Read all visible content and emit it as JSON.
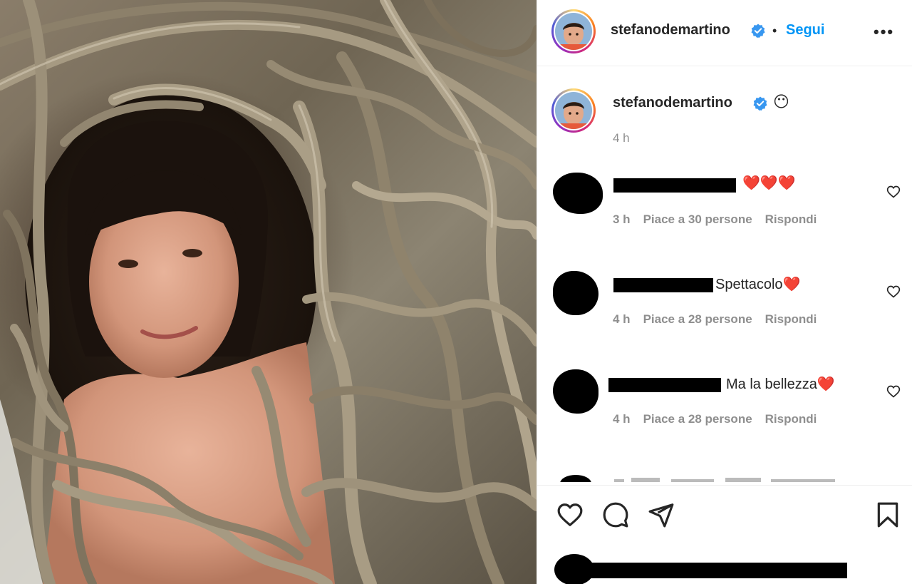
{
  "post": {
    "author": "stefanodemartino",
    "follow_label": "Segui",
    "separator": "•",
    "more_label": "•••"
  },
  "caption": {
    "author": "stefanodemartino",
    "emoji": "😶",
    "time": "4 h"
  },
  "comments": [
    {
      "text": "❤️❤️❤️",
      "time": "3 h",
      "likes": "Piace a 30 persone",
      "reply": "Rispondi"
    },
    {
      "text": "Spettacolo❤️",
      "time": "4 h",
      "likes": "Piace a 28 persone",
      "reply": "Rispondi"
    },
    {
      "text": "Ma la bellezza❤️",
      "time": "4 h",
      "likes": "Piace a 28 persone",
      "reply": "Rispondi"
    }
  ],
  "colors": {
    "accent_blue": "#0095f6",
    "secondary_text": "#8e8e8e",
    "primary_text": "#262626"
  },
  "icons": {
    "verified": "verified-badge-icon",
    "like": "heart-icon",
    "comment": "comment-icon",
    "share": "paper-plane-icon",
    "save": "bookmark-icon"
  }
}
